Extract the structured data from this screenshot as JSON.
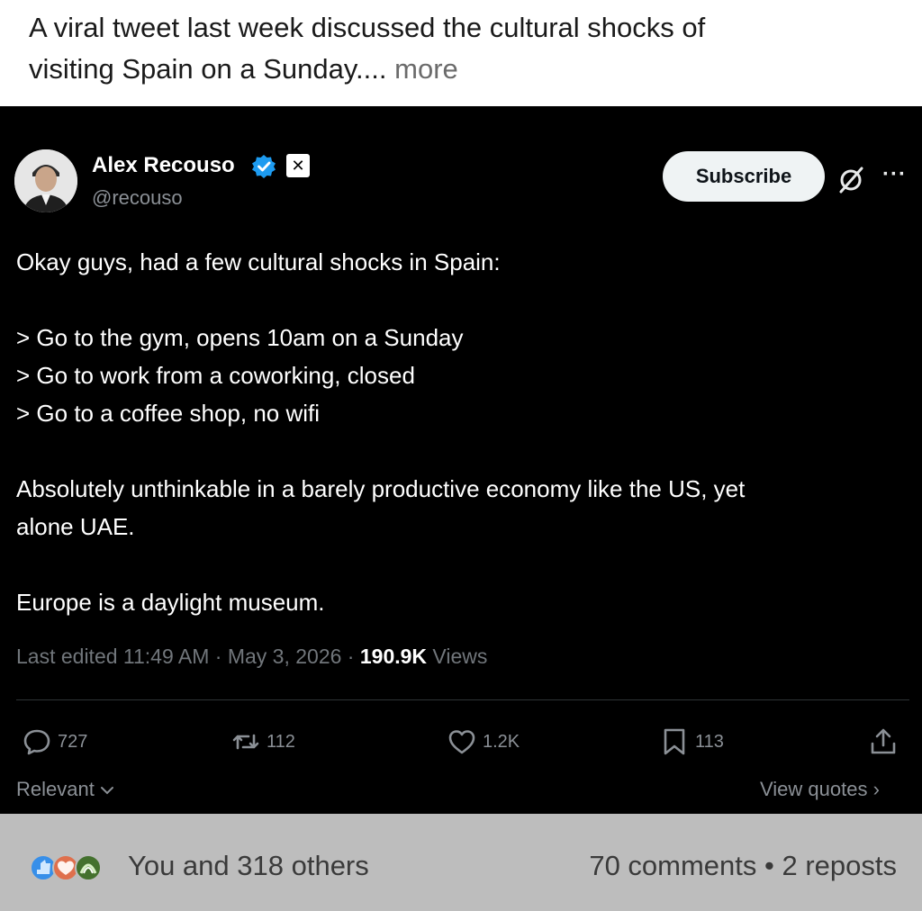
{
  "caption": {
    "line1": "A viral tweet last week discussed the cultural shocks of",
    "line2": "visiting Spain on a Sunday....",
    "more": "more"
  },
  "tweet": {
    "author": "Alex Recouso",
    "handle": "@recouso",
    "x_badge": "✕",
    "subscribe_label": "Subscribe",
    "more_label": "···",
    "lines": [
      "Okay guys, had a few cultural shocks in Spain:",
      "> Go to the gym, opens 10am on a Sunday",
      "> Go to work from a coworking, closed",
      "> Go to a coffee shop, no wifi",
      "Absolutely unthinkable in a barely productive economy like the US, yet",
      "alone UAE.",
      "Europe is a daylight museum."
    ],
    "meta_prefix": "Last edited 11:49 AM · May 3, 2026 · ",
    "views_count": "190.9K",
    "views_label": " Views",
    "stats": {
      "replies": "727",
      "reposts": "112",
      "likes": "1.2K",
      "bookmarks": "113"
    },
    "relevant_label": "Relevant",
    "view_quotes_label": "View quotes ›"
  },
  "footer": {
    "reactions_text": "You and 318 others",
    "social_stats": "70 comments • 2 reposts"
  },
  "colors": {
    "verified_blue": "#1d9bf0",
    "tweet_bg": "#000000",
    "muted": "#71767b",
    "footer_bg": "#bdbdbd"
  }
}
